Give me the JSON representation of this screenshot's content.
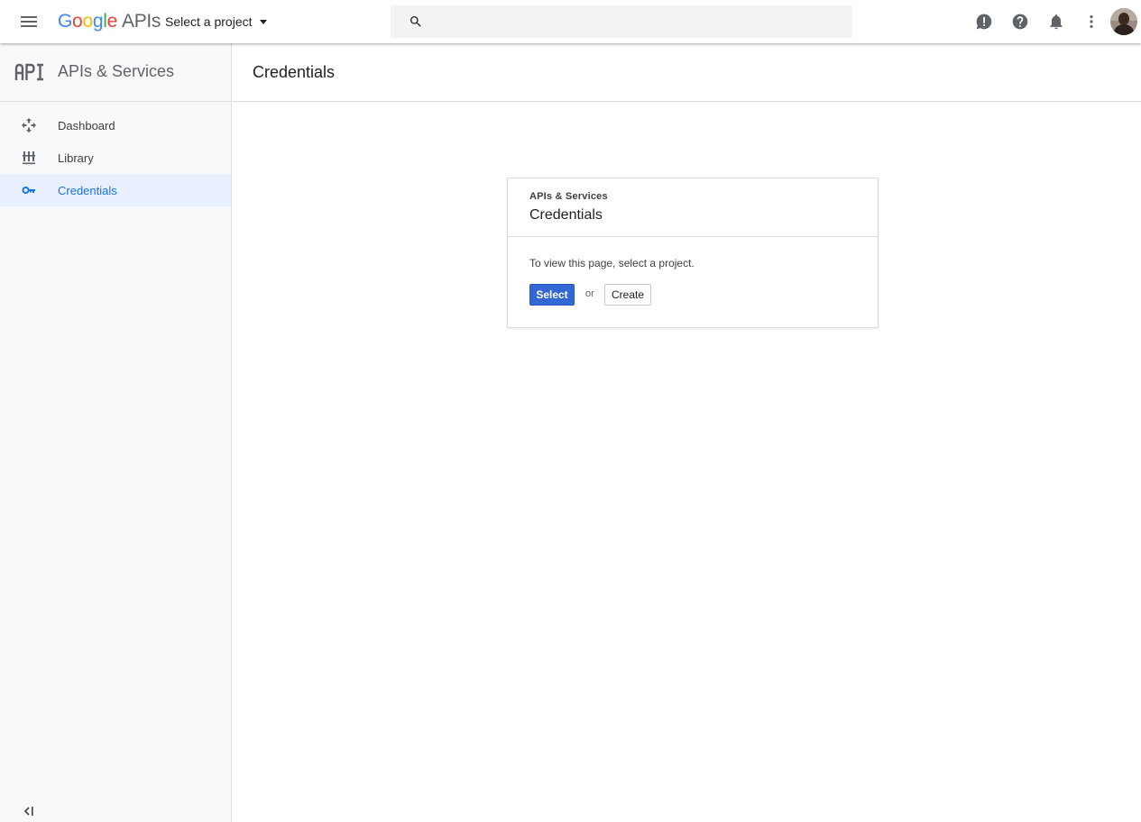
{
  "header": {
    "menu_icon": "hamburger-menu-icon",
    "logo": {
      "letters": [
        "G",
        "o",
        "o",
        "g",
        "l",
        "e"
      ],
      "suffix": "APIs"
    },
    "project_selector": {
      "label": "Select a project",
      "icon": "caret-down-icon"
    },
    "search": {
      "placeholder": "",
      "value": "",
      "icon": "search-icon"
    },
    "icons": [
      "feedback-icon",
      "help-icon",
      "notifications-icon",
      "more-vert-icon"
    ],
    "avatar": "user-avatar"
  },
  "sidebar": {
    "logo_icon": "api-logo-icon",
    "title": "APIs & Services",
    "items": [
      {
        "label": "Dashboard",
        "icon": "dashboard-icon",
        "active": false
      },
      {
        "label": "Library",
        "icon": "library-icon",
        "active": false
      },
      {
        "label": "Credentials",
        "icon": "key-icon",
        "active": true
      }
    ],
    "collapse_icon": "collapse-sidebar-icon"
  },
  "main": {
    "title": "Credentials",
    "card": {
      "eyebrow": "APIs & Services",
      "title": "Credentials",
      "message": "To view this page, select a project.",
      "select_label": "Select",
      "or_label": "or",
      "create_label": "Create"
    }
  },
  "colors": {
    "accent": "#1a73e8",
    "primary_button": "#3367d6",
    "active_nav_bg": "#e8f0fe",
    "sidebar_bg": "#f8f9fa",
    "search_bg": "#f1f3f4",
    "google_blue": "#4285F4",
    "google_red": "#EA4335",
    "google_yellow": "#FBBC05",
    "google_green": "#34A853"
  }
}
